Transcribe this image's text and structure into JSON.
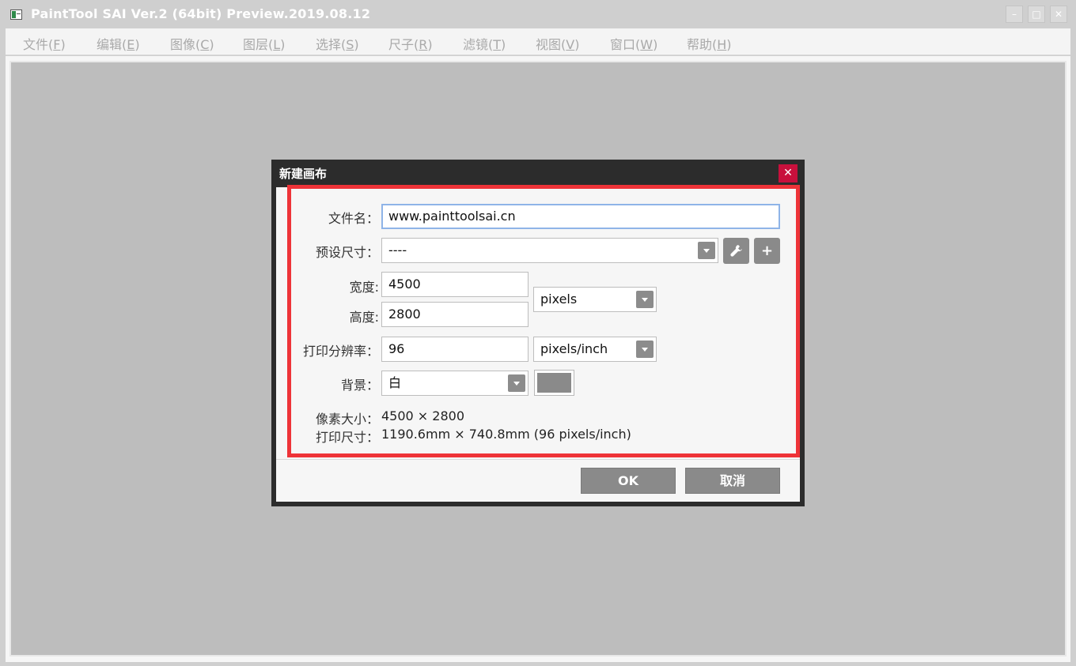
{
  "window": {
    "title": "PaintTool SAI Ver.2 (64bit) Preview.2019.08.12",
    "minimize_glyph": "–",
    "maximize_glyph": "□",
    "close_glyph": "✕"
  },
  "menu": [
    {
      "label": "文件(",
      "accel": "F",
      "tail": ")"
    },
    {
      "label": "编辑(",
      "accel": "E",
      "tail": ")"
    },
    {
      "label": "图像(",
      "accel": "C",
      "tail": ")"
    },
    {
      "label": "图层(",
      "accel": "L",
      "tail": ")"
    },
    {
      "label": "选择(",
      "accel": "S",
      "tail": ")"
    },
    {
      "label": "尺子(",
      "accel": "R",
      "tail": ")"
    },
    {
      "label": "滤镜(",
      "accel": "T",
      "tail": ")"
    },
    {
      "label": "视图(",
      "accel": "V",
      "tail": ")"
    },
    {
      "label": "窗口(",
      "accel": "W",
      "tail": ")"
    },
    {
      "label": "帮助(",
      "accel": "H",
      "tail": ")"
    }
  ],
  "dialog": {
    "title": "新建画布",
    "close_glyph": "✕",
    "filename_label": "文件名：",
    "filename_value": "www.painttoolsai.cn",
    "preset_label": "预设尺寸：",
    "preset_value": "----",
    "width_label": "宽度:",
    "width_value": "4500",
    "height_label": "高度:",
    "height_value": "2800",
    "size_unit": "pixels",
    "resolution_label": "打印分辨率：",
    "resolution_value": "96",
    "resolution_unit": "pixels/inch",
    "background_label": "背景：",
    "background_value": "白",
    "background_swatch_color": "#8a8a8a",
    "pixel_size_label": "像素大小：",
    "pixel_size_value": "4500 × 2800",
    "print_size_label": "打印尺寸：",
    "print_size_value": "1190.6mm × 740.8mm (96 pixels/inch)",
    "ok_label": "OK",
    "cancel_label": "取消",
    "wrench_glyph": "🔧",
    "plus_glyph": "+"
  },
  "colors": {
    "highlight": "#ee3338",
    "close_button": "#c8103c",
    "dialog_frame": "#2c2c2c"
  }
}
